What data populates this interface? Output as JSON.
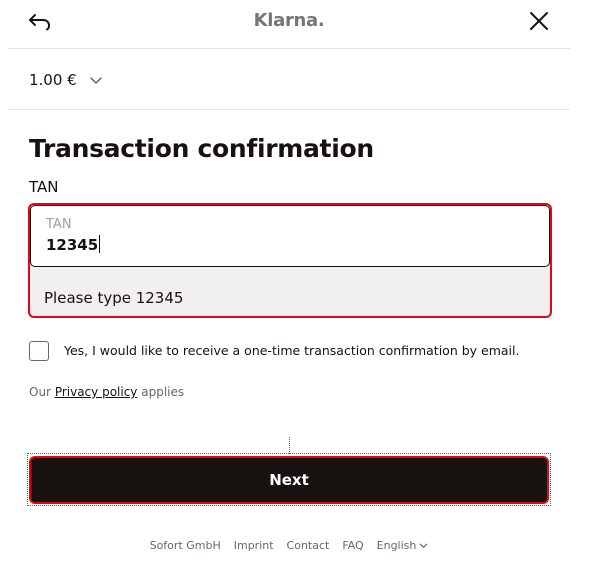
{
  "header": {
    "logo": "Klarna.",
    "back_icon": "back-arrow-icon",
    "close_icon": "close-icon"
  },
  "amount": {
    "value": "1.00 €",
    "icon": "chevron-down-icon"
  },
  "form": {
    "title": "Transaction confirmation",
    "tan_label": "TAN",
    "tan_field_label": "TAN",
    "tan_value": "12345",
    "hint": "Please type 12345",
    "checkbox_label": "Yes, I would like to receive a one-time transaction confirmation by email.",
    "checkbox_checked": false,
    "privacy_prefix": "Our",
    "privacy_link": "Privacy policy",
    "privacy_suffix": "applies",
    "next_label": "Next"
  },
  "footer": {
    "company": "Sofort GmbH",
    "imprint": "Imprint",
    "contact": "Contact",
    "faq": "FAQ",
    "language": "English"
  },
  "colors": {
    "brand_text": "#17120f",
    "highlight": "#e30613",
    "muted": "#6b6663",
    "logo": "#7a7572"
  }
}
